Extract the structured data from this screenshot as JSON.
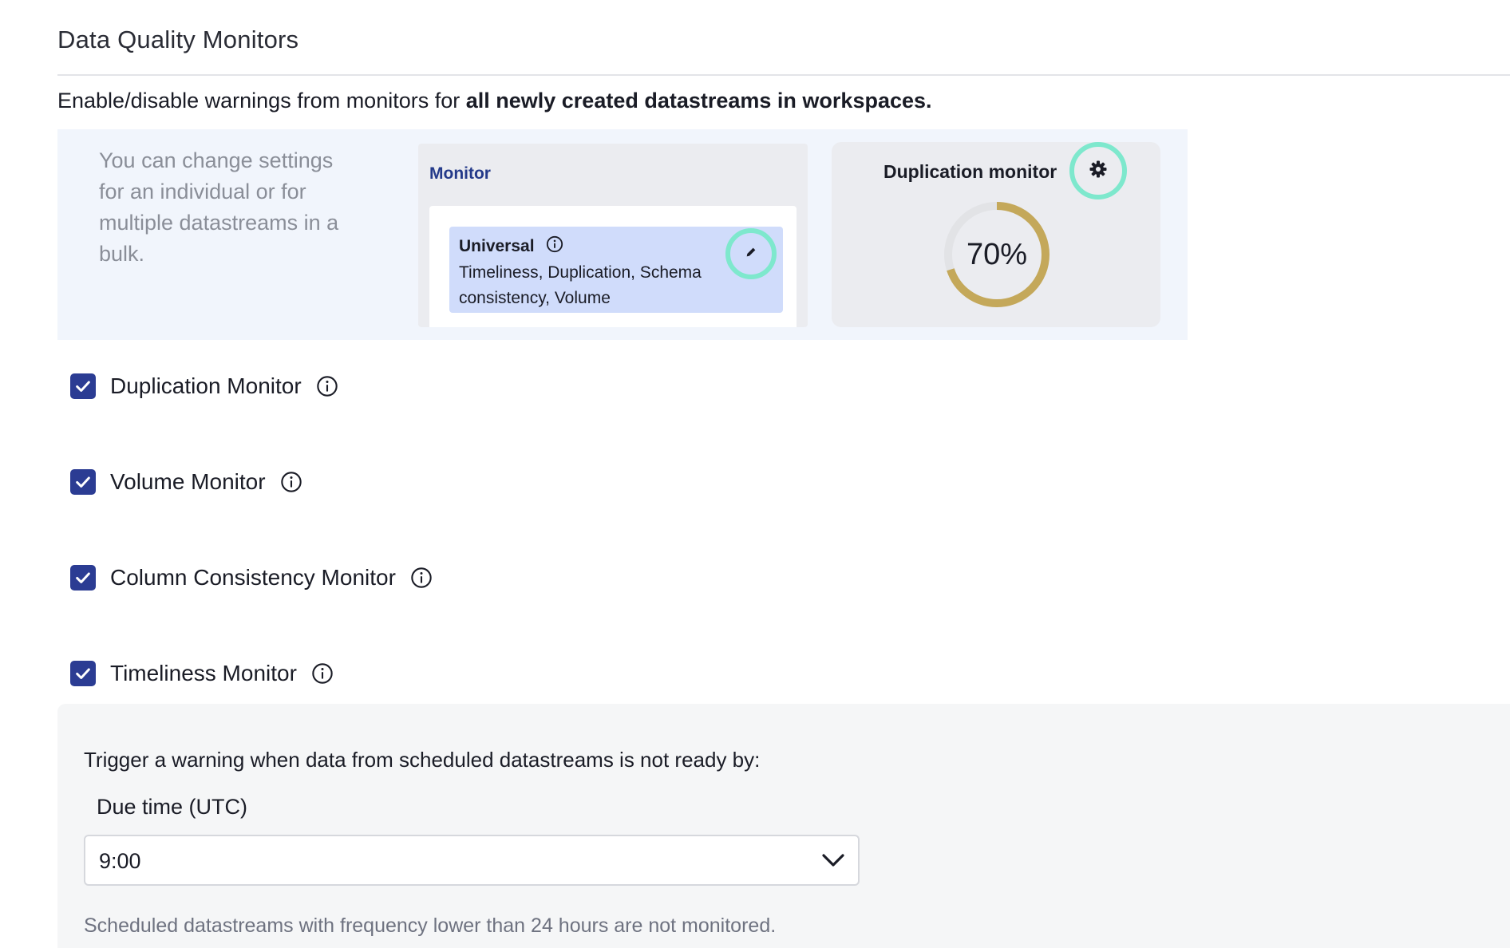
{
  "page": {
    "title": "Data Quality Monitors",
    "intro_prefix": "Enable/disable warnings from monitors for ",
    "intro_bold": "all newly created datastreams in workspaces."
  },
  "info_panel": {
    "text": "You can change settings for an individual or for multiple datastreams in a bulk.",
    "monitor_card": {
      "title": "Monitor",
      "item_title": "Universal",
      "item_description": "Timeliness, Duplication, Schema consistency, Volume"
    },
    "duplication_card": {
      "title": "Duplication monitor",
      "gauge_label": "70%",
      "gauge_fraction": 0.7
    }
  },
  "monitors": [
    {
      "label": "Duplication Monitor",
      "checked": true
    },
    {
      "label": "Volume Monitor",
      "checked": true
    },
    {
      "label": "Column Consistency Monitor",
      "checked": true
    },
    {
      "label": "Timeliness Monitor",
      "checked": true
    }
  ],
  "timeliness": {
    "trigger_text": "Trigger a warning when data from scheduled datastreams is not ready by:",
    "due_label": "Due time (UTC)",
    "due_value": "9:00",
    "note": "Scheduled datastreams with frequency lower than 24 hours are not monitored."
  },
  "colors": {
    "accent": "#2b3c93",
    "highlight_ring": "#7ee8cd",
    "gauge": "#c4a85a",
    "gauge_track": "#e2e3e6"
  }
}
